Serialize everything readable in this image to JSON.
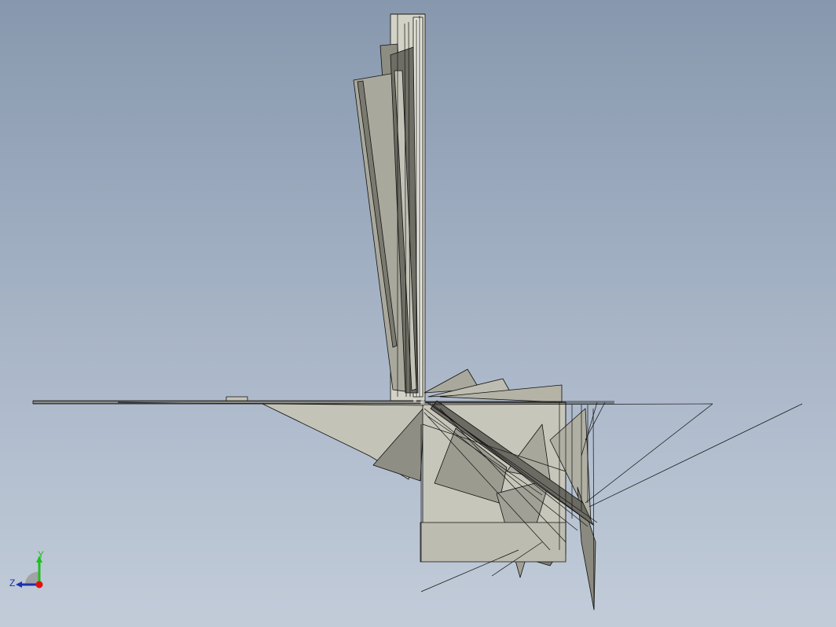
{
  "viewport": {
    "background_top": "#8798ae",
    "background_bottom": "#c2ccd9"
  },
  "model": {
    "face_color": "#b4b3a6",
    "face_light": "#c9c8bc",
    "face_dark": "#8e8d82",
    "edge_color": "#111111"
  },
  "triad": {
    "y_label": "Y",
    "z_label": "Z",
    "x_color": "#e01010",
    "y_color": "#1fbf1f",
    "z_color": "#1f2fb0",
    "icon": "coordinate-triad-icon"
  }
}
